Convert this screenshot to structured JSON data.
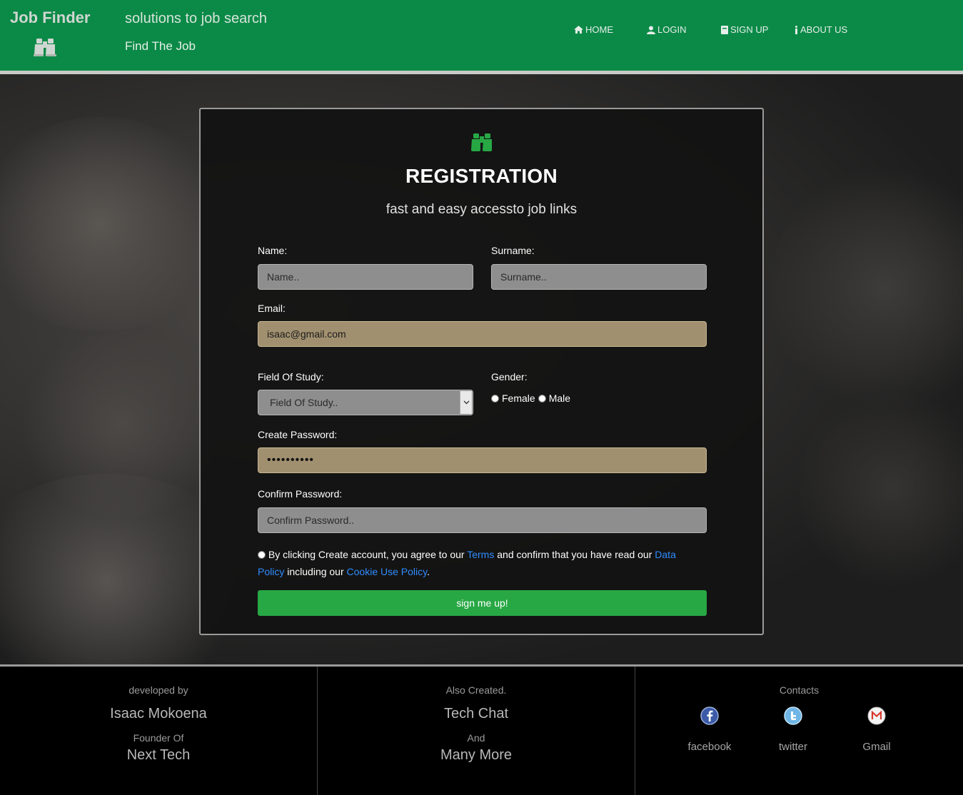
{
  "header": {
    "brand": "Job Finder",
    "tagline": "solutions to job search",
    "subtitle": "Find The Job",
    "nav": [
      {
        "label": "HOME",
        "icon": "home-icon"
      },
      {
        "label": "LOGIN",
        "icon": "user-icon"
      },
      {
        "label": "SIGN UP",
        "icon": "book-icon"
      },
      {
        "label": "ABOUT US",
        "icon": "info-icon"
      }
    ],
    "colors": {
      "background": "#0b8a47"
    }
  },
  "form": {
    "icon": "binoculars-icon",
    "title": "REGISTRATION",
    "subtitle": "fast and easy accessto job links",
    "name_label": "Name:",
    "name_placeholder": "Name..",
    "surname_label": "Surname:",
    "surname_placeholder": "Surname..",
    "email_label": "Email:",
    "email_value": "isaac@gmail.com",
    "field_label": "Field Of Study:",
    "field_value": "Field Of Study..",
    "gender_label": "Gender:",
    "gender_options": [
      "Female",
      "Male"
    ],
    "password_label": "Create Password:",
    "password_value": "••••••••••",
    "confirm_label": "Confirm Password:",
    "confirm_placeholder": "Confirm Password..",
    "terms": {
      "prefix": "By clicking Create account, you agree to our ",
      "terms_link": "Terms",
      "middle": " and confirm that you have read our ",
      "data_link": "Data Policy",
      "middle2": " including our ",
      "cookie_link": "Cookie Use Policy",
      "suffix": "."
    },
    "submit_label": "sign me up!",
    "colors": {
      "submit": "#27a844",
      "link": "#2f8cff",
      "autofill": "#a1906f"
    }
  },
  "footer": {
    "col1": {
      "small1": "developed by",
      "big1": "Isaac Mokoena",
      "small2": "Founder Of",
      "big2": "Next Tech"
    },
    "col2": {
      "small1": "Also Created.",
      "big1": "Tech Chat",
      "small2": "And",
      "big2": "Many More"
    },
    "col3": {
      "title": "Contacts",
      "links": [
        {
          "label": "facebook",
          "icon": "facebook-icon"
        },
        {
          "label": "twitter",
          "icon": "twitter-icon"
        },
        {
          "label": "Gmail",
          "icon": "gmail-icon"
        }
      ]
    }
  }
}
